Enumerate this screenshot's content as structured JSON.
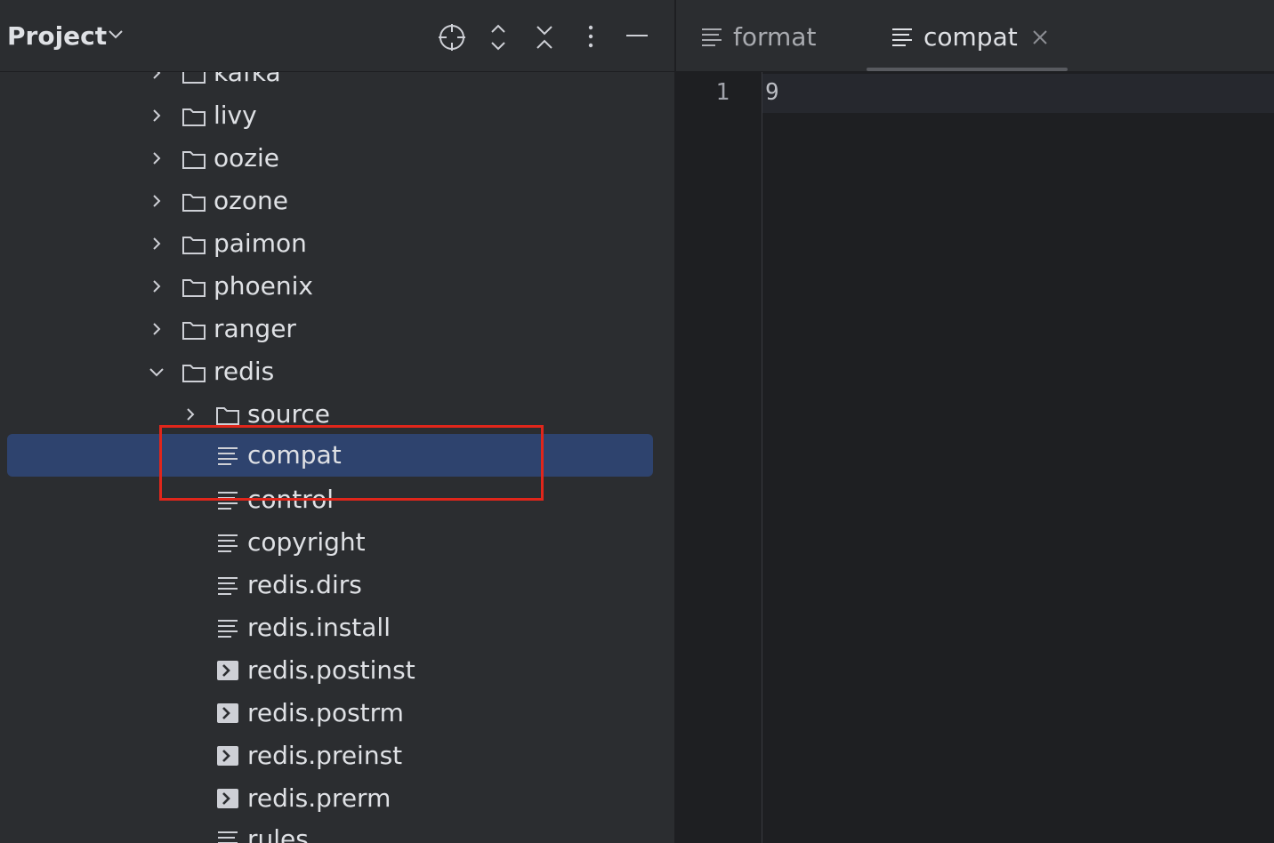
{
  "project_panel": {
    "title": "Project",
    "header_icons": [
      "locate-icon",
      "expand-collapse-icon",
      "collapse-all-icon",
      "more-options-icon",
      "minimize-icon"
    ],
    "tree": [
      {
        "label": "kafka",
        "type": "folder",
        "expanded": false
      },
      {
        "label": "livy",
        "type": "folder",
        "expanded": false
      },
      {
        "label": "oozie",
        "type": "folder",
        "expanded": false
      },
      {
        "label": "ozone",
        "type": "folder",
        "expanded": false
      },
      {
        "label": "paimon",
        "type": "folder",
        "expanded": false
      },
      {
        "label": "phoenix",
        "type": "folder",
        "expanded": false
      },
      {
        "label": "ranger",
        "type": "folder",
        "expanded": false
      },
      {
        "label": "redis",
        "type": "folder",
        "expanded": true
      },
      {
        "label": "source",
        "type": "folder",
        "expanded": false
      },
      {
        "label": "compat",
        "type": "text-file",
        "selected": true
      },
      {
        "label": "control",
        "type": "text-file"
      },
      {
        "label": "copyright",
        "type": "text-file"
      },
      {
        "label": "redis.dirs",
        "type": "text-file"
      },
      {
        "label": "redis.install",
        "type": "text-file"
      },
      {
        "label": "redis.postinst",
        "type": "script-file"
      },
      {
        "label": "redis.postrm",
        "type": "script-file"
      },
      {
        "label": "redis.preinst",
        "type": "script-file"
      },
      {
        "label": "redis.prerm",
        "type": "script-file"
      },
      {
        "label": "rules",
        "type": "text-file"
      }
    ]
  },
  "editor": {
    "tabs": [
      {
        "label": "format",
        "active": false
      },
      {
        "label": "compat",
        "active": true
      }
    ],
    "lines": [
      {
        "number": "1",
        "text": "9"
      }
    ]
  },
  "colors": {
    "panel_bg": "#2b2d30",
    "editor_bg": "#1e1f22",
    "selection": "#2e436e",
    "highlight_box": "#e0261b",
    "text": "#dfe1e5"
  }
}
